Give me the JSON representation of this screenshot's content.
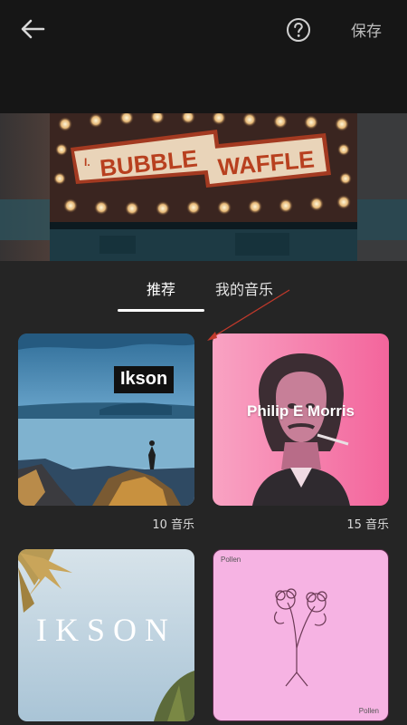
{
  "header": {
    "back_icon": "arrow-left-icon",
    "help_icon": "question-circle-icon",
    "save_label": "保存"
  },
  "preview": {
    "sign_text": "BUBBLE WAFFLE",
    "sign_prefix": "I."
  },
  "tabs": [
    {
      "label": "推荐",
      "selected": true
    },
    {
      "label": "我的音乐",
      "selected": false
    }
  ],
  "albums": [
    {
      "title": "Ikson",
      "count": "10 音乐"
    },
    {
      "title": "Philip E Morris",
      "count": "15 音乐"
    },
    {
      "title": "IKSON"
    },
    {
      "title": "Pollen",
      "footer": "Pollen"
    }
  ],
  "colors": {
    "background": "#252525",
    "topbar": "#161616",
    "philip_pink": "#f47aa8",
    "pollen_pink": "#f6b3e3",
    "annotation_arrow": "#c0392b"
  }
}
